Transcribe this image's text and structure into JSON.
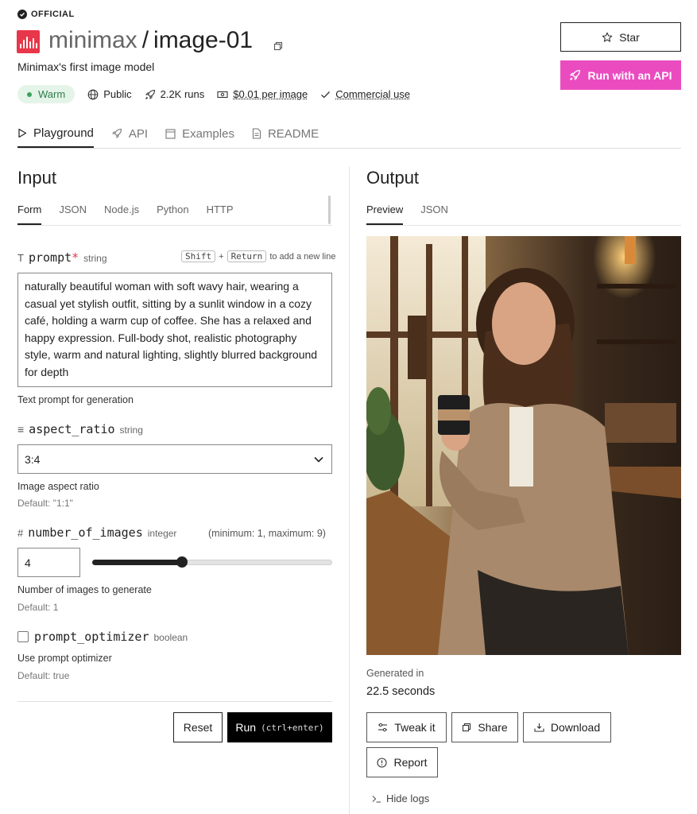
{
  "header": {
    "badge": "OFFICIAL",
    "owner": "minimax",
    "separator": "/",
    "model": "image-01",
    "subtitle": "Minimax's first image model",
    "meta": {
      "status": "Warm",
      "visibility": "Public",
      "runs": "2.2K runs",
      "price": "$0.01 per image",
      "license": "Commercial use"
    },
    "star_label": "Star",
    "api_label": "Run with an API",
    "api_color": "#ea4cc0"
  },
  "tabs": [
    {
      "label": "Playground",
      "icon": "play-icon"
    },
    {
      "label": "API",
      "icon": "rocket-icon"
    },
    {
      "label": "Examples",
      "icon": "image-icon"
    },
    {
      "label": "README",
      "icon": "document-icon"
    }
  ],
  "input": {
    "title": "Input",
    "subtabs": [
      "Form",
      "JSON",
      "Node.js",
      "Python",
      "HTTP"
    ],
    "prompt": {
      "icon": "text-icon",
      "name": "prompt",
      "required_mark": "*",
      "type": "string",
      "kbd1": "Shift",
      "plus": "+",
      "kbd2": "Return",
      "kbd_hint": "to add a new line",
      "value": "naturally beautiful woman with soft wavy hair, wearing a casual yet stylish outfit, sitting by a sunlit window in a cozy café, holding a warm cup of coffee. She has a relaxed and happy expression. Full-body shot, realistic photography style, warm and natural lighting, slightly blurred background for depth",
      "help": "Text prompt for generation"
    },
    "aspect_ratio": {
      "icon": "list-icon",
      "name": "aspect_ratio",
      "type": "string",
      "value": "3:4",
      "help": "Image aspect ratio",
      "default": "Default: \"1:1\""
    },
    "number_of_images": {
      "icon": "hash-icon",
      "name": "number_of_images",
      "type": "integer",
      "range": "(minimum: 1, maximum: 9)",
      "value": "4",
      "slider_fraction": 0.375,
      "help": "Number of images to generate",
      "default": "Default: 1"
    },
    "prompt_optimizer": {
      "name": "prompt_optimizer",
      "type": "boolean",
      "checked": false,
      "help": "Use prompt optimizer",
      "default": "Default: true"
    },
    "reset_label": "Reset",
    "run_label": "Run",
    "run_hint": "(ctrl+enter)"
  },
  "output": {
    "title": "Output",
    "subtabs": [
      "Preview",
      "JSON"
    ],
    "generated_label": "Generated in",
    "generated_value": "22.5 seconds",
    "buttons": {
      "tweak": "Tweak it",
      "share": "Share",
      "download": "Download",
      "report": "Report"
    },
    "hide_logs": "Hide logs"
  }
}
